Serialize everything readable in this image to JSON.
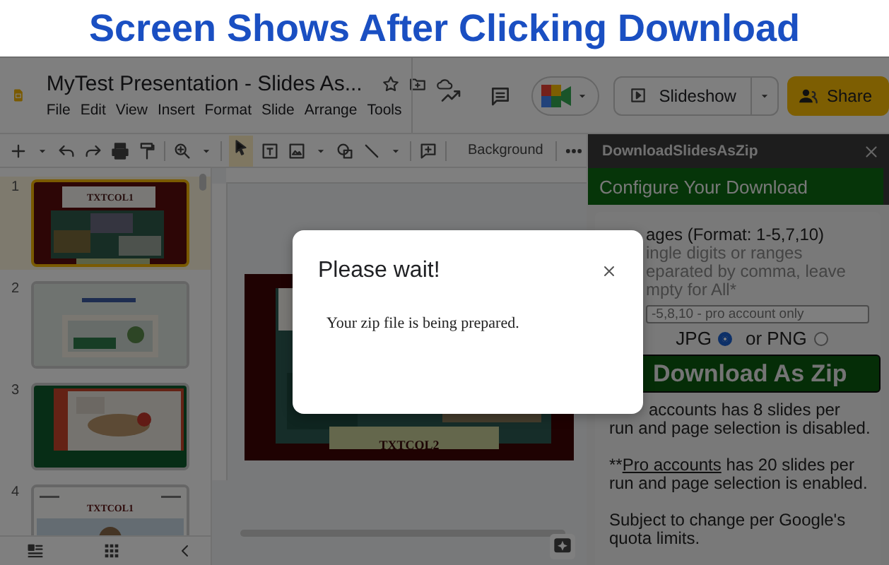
{
  "banner": {
    "title": "Screen Shows After Clicking Download"
  },
  "header": {
    "doc_title": "MyTest Presentation - Slides As...",
    "menu": [
      "File",
      "Edit",
      "View",
      "Insert",
      "Format",
      "Slide",
      "Arrange",
      "Tools"
    ],
    "slideshow_button": "Slideshow",
    "share_button": "Share"
  },
  "toolbar": {
    "background_button": "Background"
  },
  "filmstrip": {
    "slides": [
      {
        "number": "1",
        "kind": "maroon",
        "caption": "TXTCOL1",
        "selected": true
      },
      {
        "number": "2",
        "kind": "sage",
        "selected": false
      },
      {
        "number": "3",
        "kind": "green",
        "selected": false
      },
      {
        "number": "4",
        "kind": "white",
        "caption": "TXTCOL1",
        "selected": false
      }
    ]
  },
  "canvas": {
    "caption": "TXTCOL2"
  },
  "panel": {
    "title": "DownloadSlidesAsZip",
    "section": "Configure Your Download",
    "pages_label": "ages (Format: 1-5,7,10)",
    "hint_lines": [
      "ingle digits or ranges",
      "eparated by comma, leave",
      "mpty for All*"
    ],
    "pages_placeholder": "-5,8,10 - pro account only",
    "formats": [
      {
        "label": "JPG",
        "selected": true
      },
      {
        "label": "or PNG",
        "selected": false
      }
    ],
    "download_button": "Download As Zip",
    "free_note_lines": [
      "accounts has 8 slides per",
      "run and page selection is disabled."
    ],
    "pro_note": {
      "prefix": "**",
      "link": "Pro accounts",
      "text": "has 20 slides per run and page selection is enabled."
    },
    "quota_note": "Subject to change per Google's quota limits."
  },
  "dialog": {
    "title": "Please wait!",
    "message": "Your zip file is being prepared."
  }
}
